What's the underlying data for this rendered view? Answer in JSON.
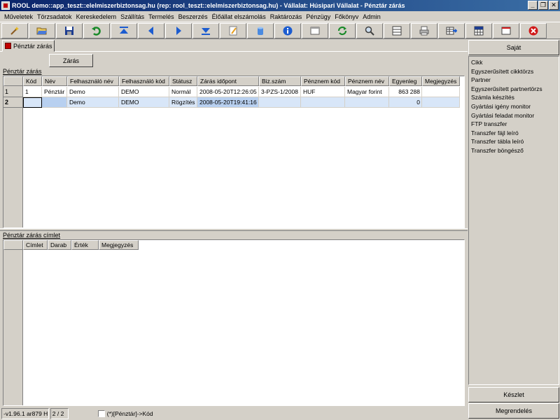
{
  "window": {
    "title": "ROOL demo::app_teszt::elelmiszerbiztonsag.hu (rep: rool_teszt::elelmiszerbiztonsag.hu) - Vállalat: Húsipari Vállalat - Pénztár zárás",
    "minimize": "_",
    "maximize": "❐",
    "close": "✕"
  },
  "menu": [
    "Műveletek",
    "Törzsadatok",
    "Kereskedelem",
    "Szállítás",
    "Termelés",
    "Beszerzés",
    "Élőállat elszámolás",
    "Raktározás",
    "Pénzügy",
    "Főkönyv",
    "Admin"
  ],
  "toolbar": {
    "icons": [
      "wizard-icon",
      "open-folder-icon",
      "save-icon",
      "undo-icon",
      "first-record-icon",
      "previous-record-icon",
      "next-record-icon",
      "last-record-icon",
      "edit-icon",
      "database-icon",
      "info-icon",
      "form-icon",
      "refresh-icon",
      "search-icon",
      "grid-icon",
      "print-icon",
      "export-icon",
      "table-icon",
      "window-icon",
      "close-icon"
    ],
    "colors": {
      "blue": "#1c5cd0",
      "green": "#1a8a2a",
      "red": "#d01818",
      "yellow": "#e8b820"
    }
  },
  "tab": {
    "label": "Pénztár zárás"
  },
  "zaras_button": "Zárás",
  "upper_grid": {
    "label": "Pénztár zárás",
    "columns": [
      "Kód",
      "Név",
      "Felhasználó név",
      "Felhasználó kód",
      "Státusz",
      "Zárás időpont",
      "Biz.szám",
      "Pénznem kód",
      "Pénznem név",
      "Egyenleg",
      "Megjegyzés"
    ],
    "rows": [
      {
        "num": "1",
        "cells": [
          "1",
          "Pénztár",
          "Demo",
          "DEMO",
          "Normál",
          "2008-05-20T12:26:05",
          "3-PZS-1/2008",
          "HUF",
          "Magyar forint",
          "863 288",
          ""
        ]
      },
      {
        "num": "2",
        "cells": [
          "",
          "",
          "Demo",
          "DEMO",
          "Rögzítés",
          "2008-05-20T19:41:16",
          "",
          "",
          "",
          "0",
          ""
        ]
      }
    ]
  },
  "lower_grid": {
    "label": "Pénztár zárás címlet",
    "columns": [
      "Címlet",
      "Darab",
      "Érték",
      "Megjegyzés"
    ]
  },
  "right_panel": {
    "top_button": "Saját",
    "items": [
      "Cikk",
      "Egyszerűsített cikktörzs",
      "Partner",
      "Egyszerűsített partnertörzs",
      "Számla készítés",
      "Gyártási igény monitor",
      "Gyártási feladat monitor",
      "FTP transzfer",
      "Transzfer fájl leíró",
      "Transzfer tábla leíró",
      "Transzfer böngésző"
    ],
    "bottom_buttons": [
      "Készlet",
      "Megrendelés"
    ]
  },
  "status": {
    "version": "-v1.96.1 ar879 H",
    "record": "2 / 2",
    "filter": "(*)[Pénztár]->Kód"
  }
}
